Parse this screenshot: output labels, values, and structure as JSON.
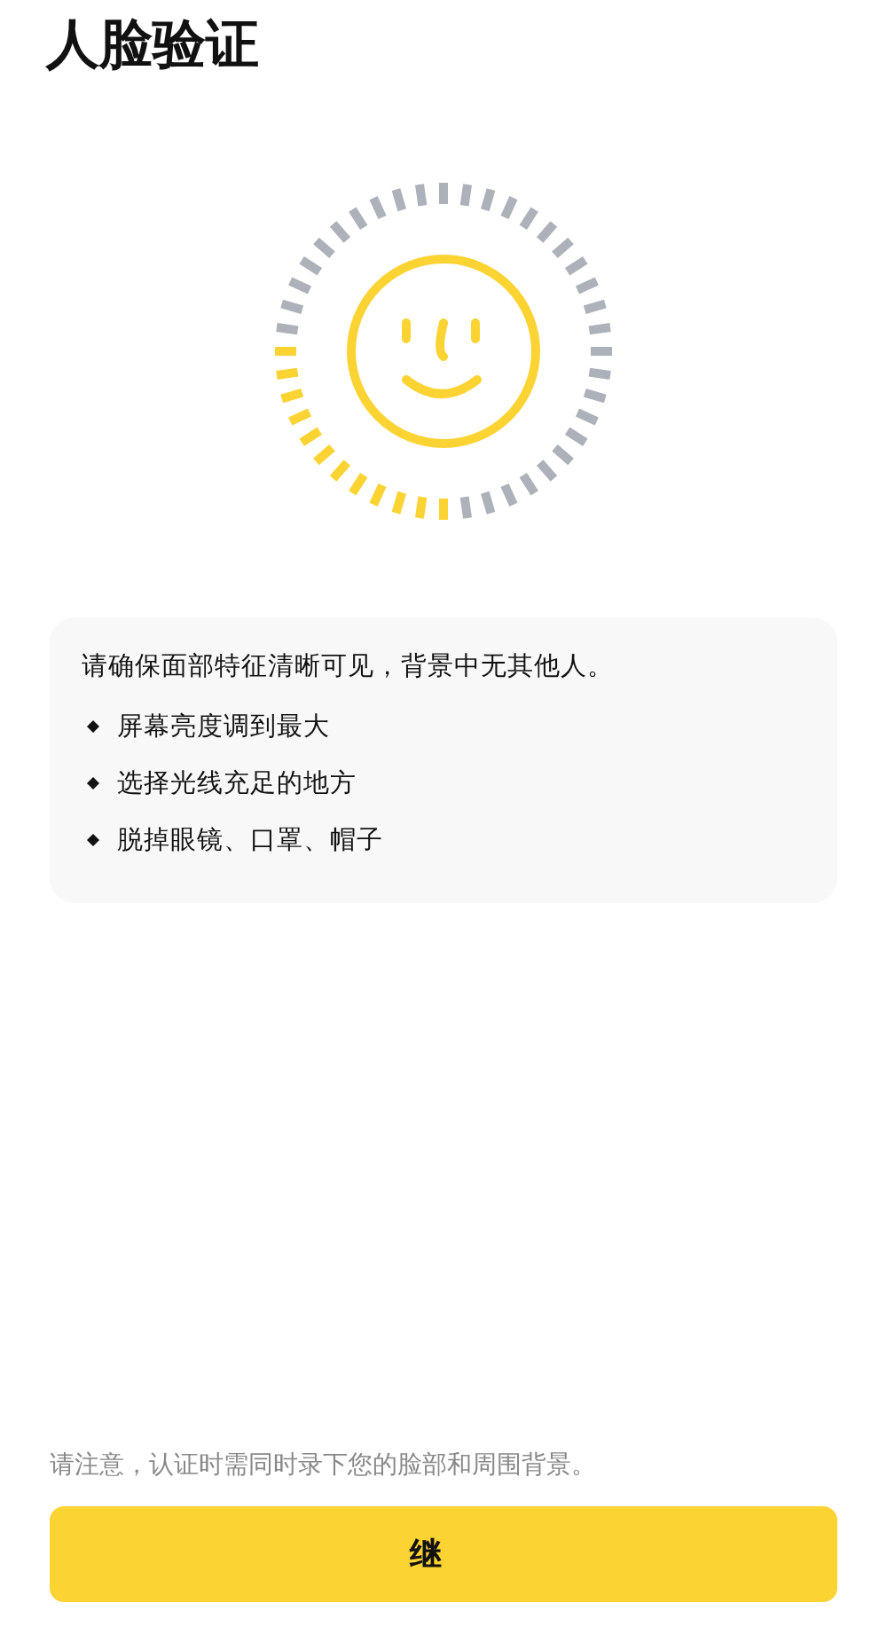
{
  "title": "人脸验证",
  "tips": {
    "heading": "请确保面部特征清晰可见，背景中无其他人。",
    "items": [
      "屏幕亮度调到最大",
      "选择光线充足的地方",
      "脱掉眼镜、口罩、帽子"
    ]
  },
  "notice": "请注意，认证时需同时录下您的脸部和周围背景。",
  "primary_button": {
    "label": "继"
  }
}
